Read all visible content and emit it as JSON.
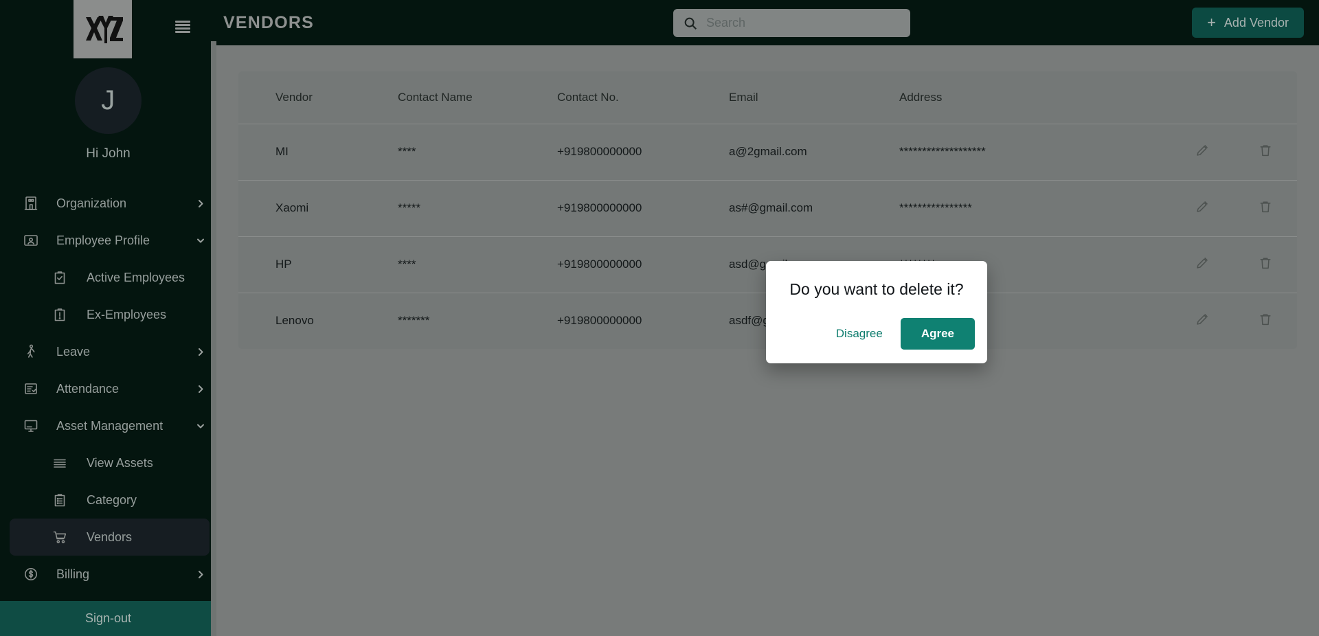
{
  "brand": {
    "logo_text": "XYZ",
    "menu_icon": "hamburger-icon"
  },
  "user": {
    "initial": "J",
    "greeting": "Hi John"
  },
  "sidebar": {
    "items": [
      {
        "label": "Organization",
        "icon": "building-icon",
        "level": 0,
        "chevron": "right",
        "active": false
      },
      {
        "label": "Employee Profile",
        "icon": "id-card-icon",
        "level": 0,
        "chevron": "down",
        "active": false
      },
      {
        "label": "Active Employees",
        "icon": "clipboard-check-icon",
        "level": 1,
        "chevron": "",
        "active": false
      },
      {
        "label": "Ex-Employees",
        "icon": "clipboard-alert-icon",
        "level": 1,
        "chevron": "",
        "active": false
      },
      {
        "label": "Leave",
        "icon": "walking-person-icon",
        "level": 0,
        "chevron": "right",
        "active": false
      },
      {
        "label": "Attendance",
        "icon": "list-check-icon",
        "level": 0,
        "chevron": "right",
        "active": false
      },
      {
        "label": "Asset Management",
        "icon": "monitor-icon",
        "level": 0,
        "chevron": "down",
        "active": false
      },
      {
        "label": "View Assets",
        "icon": "lines-icon",
        "level": 1,
        "chevron": "",
        "active": false
      },
      {
        "label": "Category",
        "icon": "clipboard-list-icon",
        "level": 1,
        "chevron": "",
        "active": false
      },
      {
        "label": "Vendors",
        "icon": "shopping-cart-icon",
        "level": 1,
        "chevron": "",
        "active": true
      },
      {
        "label": "Billing",
        "icon": "dollar-circle-icon",
        "level": 0,
        "chevron": "right",
        "active": false
      }
    ],
    "signout_label": "Sign-out"
  },
  "header": {
    "title": "VENDORS",
    "menu_icon": "hamburger-icon",
    "search": {
      "placeholder": "Search",
      "value": "",
      "icon": "search-icon"
    },
    "add_button": {
      "label": "Add Vendor",
      "icon": "plus-icon"
    }
  },
  "table": {
    "columns": [
      "Vendor",
      "Contact Name",
      "Contact No.",
      "Email",
      "Address"
    ],
    "rows": [
      {
        "vendor": "MI",
        "contact_name": "****",
        "contact_no": "+919800000000",
        "email": "a@2gmail.com",
        "address": "*******************"
      },
      {
        "vendor": "Xaomi",
        "contact_name": "*****",
        "contact_no": "+919800000000",
        "email": "as#@gmail.com",
        "address": "****************"
      },
      {
        "vendor": "HP",
        "contact_name": "****",
        "contact_no": "+919800000000",
        "email": "asd@gmail.com",
        "address": "********"
      },
      {
        "vendor": "Lenovo",
        "contact_name": "*******",
        "contact_no": "+919800000000",
        "email": "asdf@gmail.com",
        "address": "*******************"
      }
    ],
    "row_actions": {
      "edit_icon": "pencil-icon",
      "delete_icon": "trash-icon"
    }
  },
  "dialog": {
    "title": "Do you want to delete it?",
    "disagree_label": "Disagree",
    "agree_label": "Agree"
  },
  "colors": {
    "sidebar_bg": "#04150f",
    "accent_teal": "#0f8172",
    "signout_bg": "#0f4c44",
    "add_button_bg": "#0c4a42",
    "overlay": "#787b7a",
    "active_item_bg": "#161d22"
  }
}
